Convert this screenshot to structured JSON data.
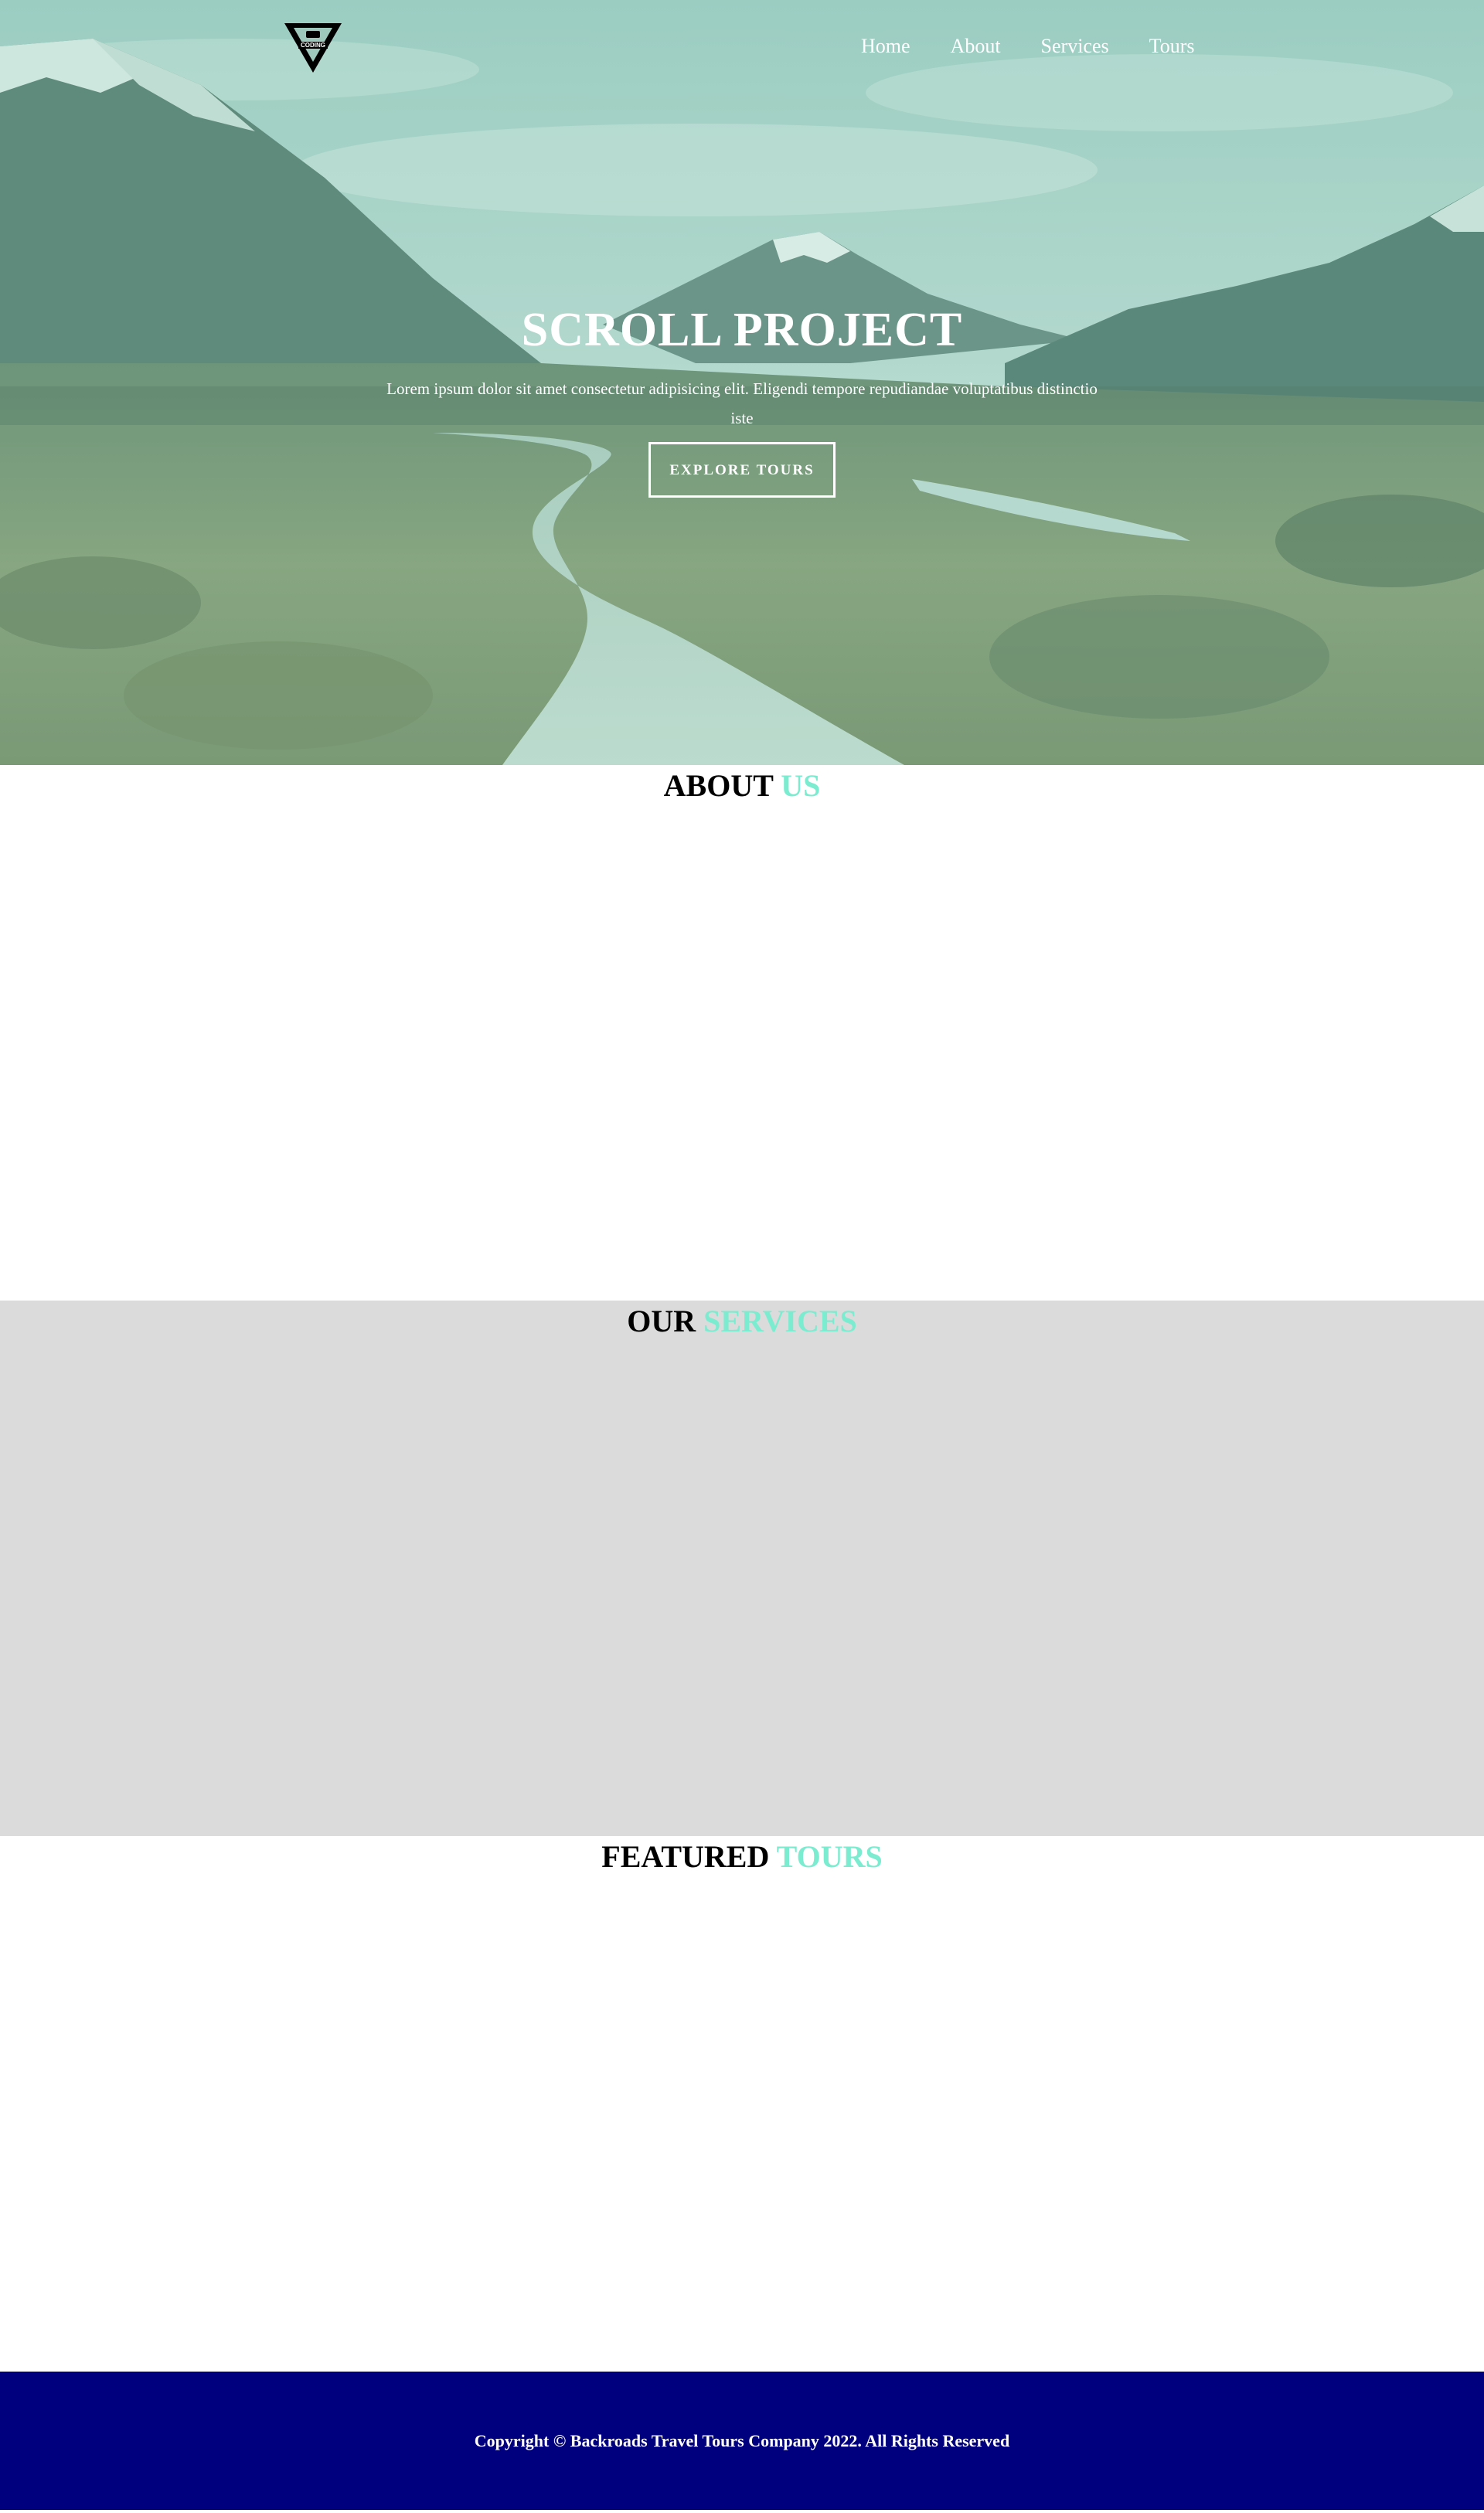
{
  "brand": {
    "logo_text": "CODING"
  },
  "nav": {
    "items": [
      {
        "label": "Home"
      },
      {
        "label": "About"
      },
      {
        "label": "Services"
      },
      {
        "label": "Tours"
      }
    ]
  },
  "hero": {
    "title": "SCROLL PROJECT",
    "text": "Lorem ipsum dolor sit amet consectetur adipisicing elit. Eligendi tempore repudiandae voluptatibus distinctio iste",
    "button_label": "EXPLORE TOURS"
  },
  "sections": {
    "about": {
      "title_main": "ABOUT",
      "title_accent": "US"
    },
    "services": {
      "title_main": "OUR",
      "title_accent": "SERVICES"
    },
    "tours": {
      "title_main": "FEATURED",
      "title_accent": "TOURS"
    }
  },
  "footer": {
    "copyright": "Copyright © Backroads Travel Tours Company 2022. All Rights Reserved"
  },
  "colors": {
    "accent": "#7cecd0",
    "services_bg": "#dcdbdb",
    "footer_bg": "#00007f"
  }
}
